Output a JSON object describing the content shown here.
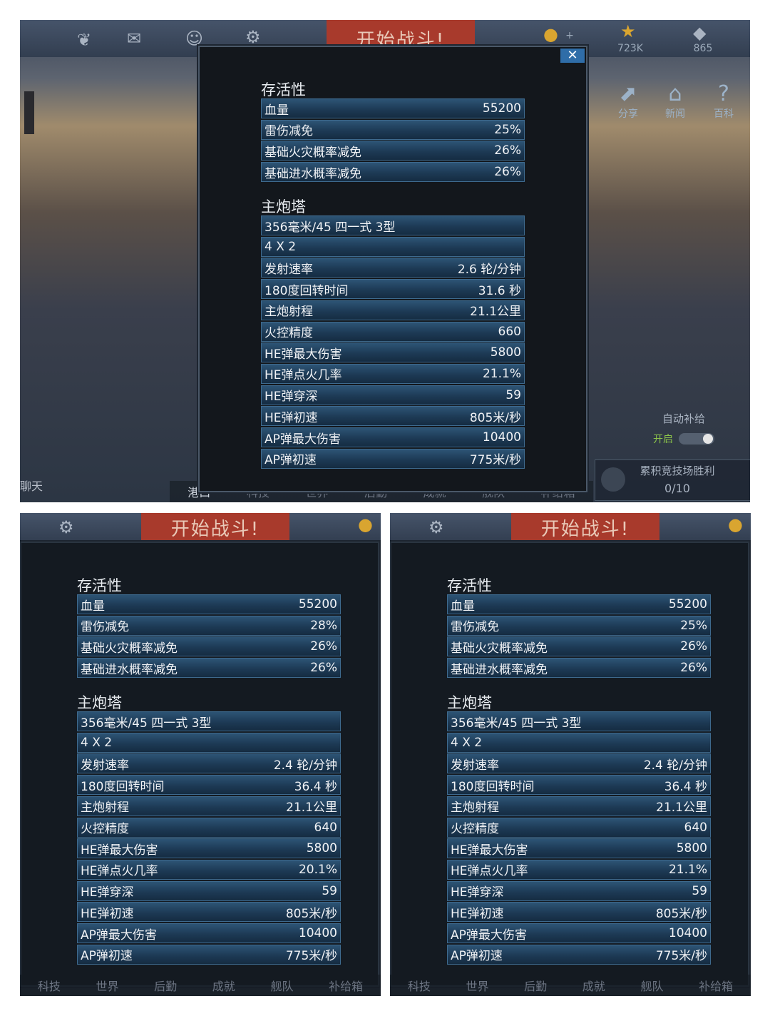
{
  "top": {
    "header": {
      "battle": "开始战斗!",
      "gold_plus": "+",
      "stars": "723K",
      "gems": "865"
    },
    "side": {
      "share": "分享",
      "news": "新闻",
      "wiki": "百科"
    },
    "auto_supply": {
      "label": "自动补给",
      "toggle": "开启"
    },
    "arena": {
      "label": "累积竞技场胜利",
      "value": "0/10"
    },
    "chat": "聊天",
    "nav": [
      "港口",
      "科技",
      "世界",
      "后勤",
      "成就",
      "舰队",
      "补给箱"
    ],
    "survival_title": "存活性",
    "survival": [
      {
        "label": "血量",
        "value": "55200"
      },
      {
        "label": "雷伤减免",
        "value": "25%"
      },
      {
        "label": "基础火灾概率减免",
        "value": "26%"
      },
      {
        "label": "基础进水概率减免",
        "value": "26%"
      }
    ],
    "turret_title": "主炮塔",
    "turret": [
      {
        "label": "356毫米/45 四一式 3型",
        "value": ""
      },
      {
        "label": "4 X 2",
        "value": ""
      },
      {
        "label": "发射速率",
        "value": "2.6 轮/分钟"
      },
      {
        "label": "180度回转时间",
        "value": "31.6 秒"
      },
      {
        "label": "主炮射程",
        "value": "21.1公里"
      },
      {
        "label": "火控精度",
        "value": "660"
      },
      {
        "label": "HE弹最大伤害",
        "value": "5800"
      },
      {
        "label": "HE弹点火几率",
        "value": "21.1%"
      },
      {
        "label": "HE弹穿深",
        "value": "59"
      },
      {
        "label": "HE弹初速",
        "value": "805米/秒"
      },
      {
        "label": "AP弹最大伤害",
        "value": "10400"
      },
      {
        "label": "AP弹初速",
        "value": "775米/秒"
      }
    ]
  },
  "left": {
    "header": {
      "battle": "开始战斗!"
    },
    "nav": [
      "科技",
      "世界",
      "后勤",
      "成就",
      "舰队",
      "补给箱"
    ],
    "survival_title": "存活性",
    "survival": [
      {
        "label": "血量",
        "value": "55200"
      },
      {
        "label": "雷伤减免",
        "value": "28%"
      },
      {
        "label": "基础火灾概率减免",
        "value": "26%"
      },
      {
        "label": "基础进水概率减免",
        "value": "26%"
      }
    ],
    "turret_title": "主炮塔",
    "turret": [
      {
        "label": "356毫米/45 四一式 3型",
        "value": ""
      },
      {
        "label": "4 X 2",
        "value": ""
      },
      {
        "label": "发射速率",
        "value": "2.4 轮/分钟"
      },
      {
        "label": "180度回转时间",
        "value": "36.4 秒"
      },
      {
        "label": "主炮射程",
        "value": "21.1公里"
      },
      {
        "label": "火控精度",
        "value": "640"
      },
      {
        "label": "HE弹最大伤害",
        "value": "5800"
      },
      {
        "label": "HE弹点火几率",
        "value": "20.1%"
      },
      {
        "label": "HE弹穿深",
        "value": "59"
      },
      {
        "label": "HE弹初速",
        "value": "805米/秒"
      },
      {
        "label": "AP弹最大伤害",
        "value": "10400"
      },
      {
        "label": "AP弹初速",
        "value": "775米/秒"
      }
    ]
  },
  "right": {
    "header": {
      "battle": "开始战斗!"
    },
    "nav": [
      "科技",
      "世界",
      "后勤",
      "成就",
      "舰队",
      "补给箱"
    ],
    "survival_title": "存活性",
    "survival": [
      {
        "label": "血量",
        "value": "55200"
      },
      {
        "label": "雷伤减免",
        "value": "25%"
      },
      {
        "label": "基础火灾概率减免",
        "value": "26%"
      },
      {
        "label": "基础进水概率减免",
        "value": "26%"
      }
    ],
    "turret_title": "主炮塔",
    "turret": [
      {
        "label": "356毫米/45 四一式 3型",
        "value": ""
      },
      {
        "label": "4 X 2",
        "value": ""
      },
      {
        "label": "发射速率",
        "value": "2.4 轮/分钟"
      },
      {
        "label": "180度回转时间",
        "value": "36.4 秒"
      },
      {
        "label": "主炮射程",
        "value": "21.1公里"
      },
      {
        "label": "火控精度",
        "value": "640"
      },
      {
        "label": "HE弹最大伤害",
        "value": "5800"
      },
      {
        "label": "HE弹点火几率",
        "value": "21.1%"
      },
      {
        "label": "HE弹穿深",
        "value": "59"
      },
      {
        "label": "HE弹初速",
        "value": "805米/秒"
      },
      {
        "label": "AP弹最大伤害",
        "value": "10400"
      },
      {
        "label": "AP弹初速",
        "value": "775米/秒"
      }
    ]
  }
}
